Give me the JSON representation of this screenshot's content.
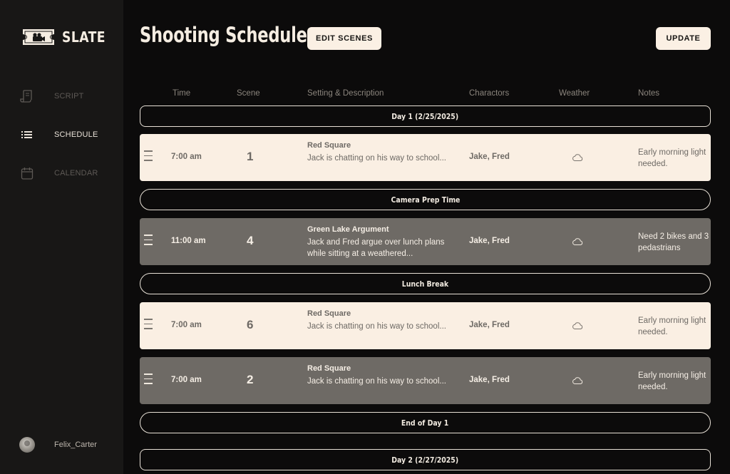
{
  "app": {
    "name": "SLATE",
    "logo_icon": "film-camera-ticket-icon"
  },
  "sidebar": {
    "items": [
      {
        "label": "SCRIPT",
        "icon": "script-scroll-icon",
        "active": false
      },
      {
        "label": "SCHEDULE",
        "icon": "list-icon",
        "active": true
      },
      {
        "label": "CALENDAR",
        "icon": "calendar-icon",
        "active": false
      }
    ],
    "user": {
      "name": "Felix_Carter"
    }
  },
  "header": {
    "title": "Shooting Schedule",
    "edit_label": "EDIT SCENES",
    "update_label": "UPDATE"
  },
  "table": {
    "columns": [
      "Time",
      "Scene",
      "Setting & Description",
      "Charactors",
      "Weather",
      "Notes"
    ]
  },
  "schedule": {
    "banners": [
      "Day 1 (2/25/2025)",
      "Camera Prep Time",
      "Lunch Break",
      "End of Day 1",
      "Day 2 (2/27/2025)"
    ],
    "rows": [
      {
        "time": "7:00 am",
        "scene": "1",
        "setting": "Red Square",
        "description": "Jack is chatting on his way to school...",
        "characters": "Jake, Fred",
        "weather": "cloud-icon",
        "notes": "Early morning light needed."
      },
      {
        "time": "11:00 am",
        "scene": "4",
        "setting": "Green Lake Argument",
        "description": "Jack and Fred argue over lunch plans while sitting at a weathered...",
        "characters": "Jake, Fred",
        "weather": "cloud-icon",
        "notes": "Need 2 bikes and 3 pedastrians"
      },
      {
        "time": "7:00 am",
        "scene": "6",
        "setting": "Red Square",
        "description": "Jack is chatting on his way to school...",
        "characters": "Jake, Fred",
        "weather": "cloud-icon",
        "notes": "Early morning light needed."
      },
      {
        "time": "7:00 am",
        "scene": "2",
        "setting": "Red Square",
        "description": "Jack is chatting on his way to school...",
        "characters": "Jake, Fred",
        "weather": "cloud-icon",
        "notes": "Early morning light needed."
      }
    ]
  },
  "colors": {
    "background": "#0c0b0b",
    "sidebar": "#181716",
    "row_light": "#faefe3",
    "row_dark": "#6e6a65",
    "button": "#fbf0e4"
  }
}
